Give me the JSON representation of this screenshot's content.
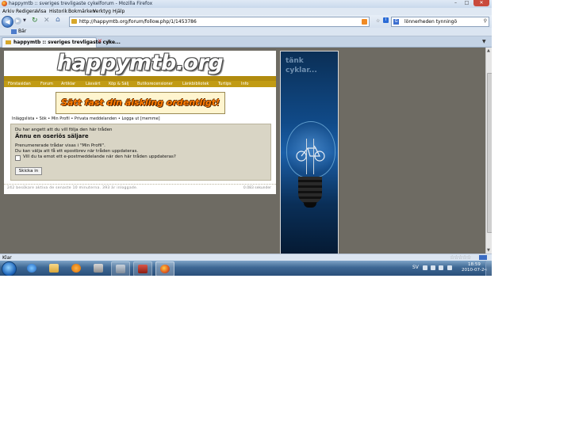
{
  "window": {
    "title": "happymtb :: sveriges trevligaste cykelforum - Mozilla Firefox"
  },
  "menu": [
    "Arkiv",
    "Redigera",
    "Visa",
    "Historik",
    "Bokmärken",
    "Verktyg",
    "Hjälp"
  ],
  "navbar": {
    "url": "http://happymtb.org/forum/follow.php/1/1453786",
    "search_value": "lönnerheden tynningö"
  },
  "bookmarks": {
    "label": "Bär"
  },
  "tab": {
    "label": "happymtb :: sveriges trevligaste cyke..."
  },
  "page": {
    "logo": "happymtb.org",
    "nav_links": [
      "Förstasidan",
      "Forum",
      "Artiklar",
      "Läsvärt",
      "Köp & Sälj",
      "Butiksrecensioner",
      "Länkbibliotek",
      "Turtips",
      "Info"
    ],
    "banner_text": "Sätt fast din älskling ordentligt!",
    "breadcrumb": "Inläggslista • Sök • Min Profil • Privata meddelanden • Logga ut [memme]",
    "notice": "Du har angett att du vill följa den här tråden",
    "thread_title": "Ännu en oseriös säljare",
    "info_line1": "Prenumererade trådar visas i \"Min Profil\".",
    "info_line2": "Du kan välja att få ett epostbrev när tråden uppdateras.",
    "checkbox_label": "Vill du ta emot ett e-postmeddelande när den här tråden uppdateras?",
    "submit_label": "Skicka in",
    "footer_left": "242 besökare aktiva de senaste 10 minuterna. 393 är inloggade.",
    "footer_right": "0.083 sekunder",
    "ad_text_1": "tänk",
    "ad_text_2": "cyklar..."
  },
  "status": {
    "text": "Klar"
  },
  "taskbar": {
    "language": "SV",
    "time": "18:59",
    "date": "2010-07-24"
  }
}
